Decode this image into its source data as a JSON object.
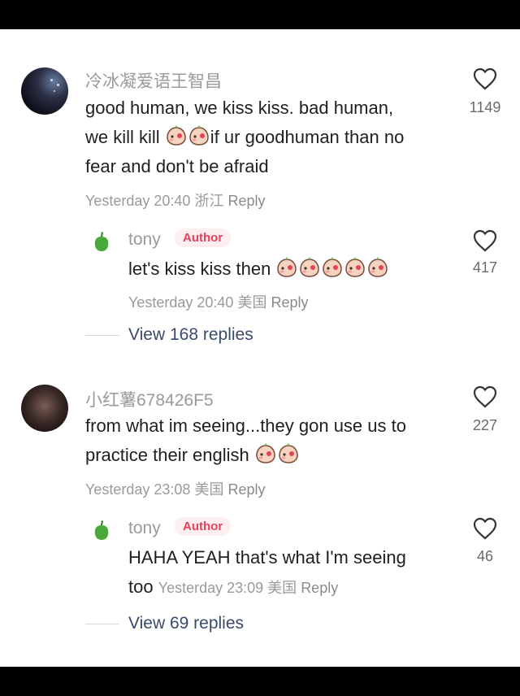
{
  "comments": [
    {
      "username": "冷冰凝爱语王智昌",
      "text_line1": "good human, we kiss kiss.  bad human,",
      "text_line2a": "we kill kill ",
      "text_line2b": "if ur goodhuman than no",
      "text_line3": "fear and don't be afraid",
      "time": "Yesterday 20:40",
      "location": "浙江",
      "reply_label": "Reply",
      "likes": "1149",
      "emojis": [
        "blush-kiss-emoji",
        "blush-kiss-emoji"
      ],
      "author_reply": {
        "username": "tony",
        "badge": "Author",
        "text": "let's kiss kiss then ",
        "time": "Yesterday 20:40",
        "location": "美国",
        "reply_label": "Reply",
        "likes": "417",
        "emojis": [
          "blush-kiss-emoji",
          "blush-kiss-emoji",
          "blush-kiss-emoji",
          "blush-kiss-emoji",
          "blush-kiss-emoji"
        ]
      },
      "view_replies": "View 168 replies"
    },
    {
      "username": "小红薯678426F5",
      "text_line1": "from what im seeing...they gon use us to",
      "text_line2": "practice their english ",
      "time": "Yesterday 23:08",
      "location": "美国",
      "reply_label": "Reply",
      "likes": "227",
      "emojis": [
        "blush-kiss-emoji",
        "blush-kiss-emoji"
      ],
      "author_reply": {
        "username": "tony",
        "badge": "Author",
        "text_line1": "HAHA YEAH that's what I'm seeing",
        "text_line2": "too",
        "time": "Yesterday 23:09",
        "location": "美国",
        "reply_label": "Reply",
        "likes": "46"
      },
      "view_replies": "View 69 replies"
    }
  ],
  "icons": {
    "like": "heart-outline-icon",
    "author_avatar": "green-pepper-icon"
  },
  "colors": {
    "author_badge": "#e8415a",
    "author_badge_bg": "#fdeef0",
    "view_replies": "#3a4a6a"
  }
}
